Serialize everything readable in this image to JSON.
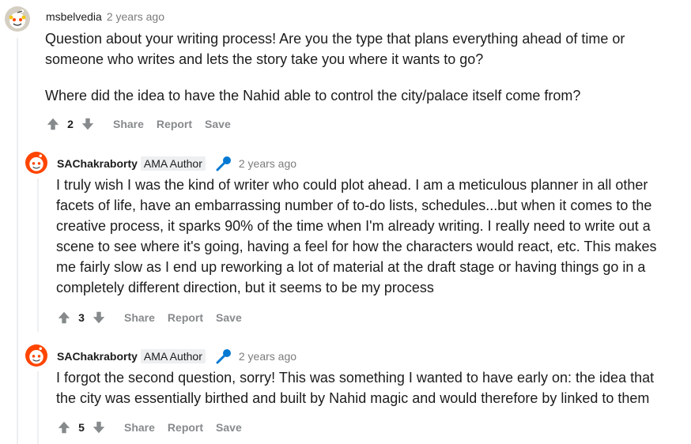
{
  "comments": [
    {
      "username": "msbelvedia",
      "timestamp": "2 years ago",
      "paragraphs": [
        "Question about your writing process! Are you the type that plans everything ahead of time or",
        "someone who writes and lets the story take you where it wants to go?",
        "Where did the idea to have the Nahid able to control the city/palace itself come from?"
      ],
      "votes": "2",
      "actions": {
        "share": "Share",
        "report": "Report",
        "save": "Save"
      }
    },
    {
      "username": "SAChakraborty",
      "flair": "AMA Author",
      "timestamp": "2 years ago",
      "paragraphs": [
        "I truly wish I was the kind of writer who could plot ahead. I am a meticulous planner in all other",
        "facets of life, have an embarrassing number of to-do lists, schedules...but when it comes to the",
        "creative process, it sparks 90% of the time when I'm already writing. I really need to write out a",
        "scene to see where it's going, having a feel for how the characters would react, etc. This makes",
        "me fairly slow as I end up reworking a lot of material at the draft stage or having things go in a",
        "completely different direction, but it seems to be my process"
      ],
      "votes": "3",
      "actions": {
        "share": "Share",
        "report": "Report",
        "save": "Save"
      }
    },
    {
      "username": "SAChakraborty",
      "flair": "AMA Author",
      "timestamp": "2 years ago",
      "paragraphs": [
        "I forgot the second question, sorry! This was something I wanted to have early on: the idea that",
        "the city was essentially birthed and built by Nahid magic and would therefore by linked to them"
      ],
      "votes": "5",
      "actions": {
        "share": "Share",
        "report": "Report",
        "save": "Save"
      }
    }
  ],
  "icons": {
    "avatar_1": "snoo-avatar-icon",
    "avatar_2": "snoo-avatar-icon",
    "upvote": "upvote-arrow-icon",
    "downvote": "downvote-arrow-icon",
    "verified": "microphone-icon"
  },
  "colors": {
    "thread_line": "#edeff1",
    "muted_text": "#878a8c",
    "timestamp": "#7c7c7c",
    "verified_icon": "#0079d3"
  }
}
